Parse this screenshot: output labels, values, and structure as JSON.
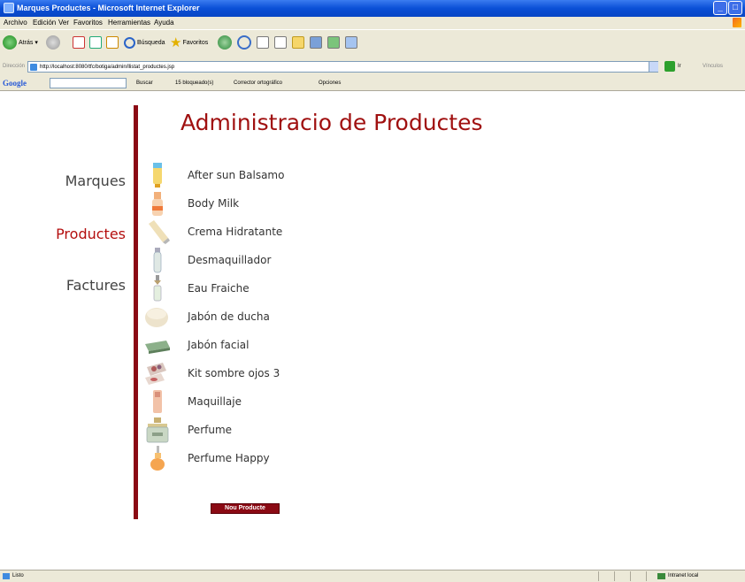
{
  "window": {
    "title": "Marques Productes - Microsoft Internet Explorer"
  },
  "menu": [
    "Archivo",
    "Edición",
    "Ver",
    "Favoritos",
    "Herramientas",
    "Ayuda"
  ],
  "toolbar": {
    "back": "Atrás",
    "search": "Búsqueda",
    "favorites": "Favoritos"
  },
  "address": {
    "label": "Dirección",
    "url": "http://localhost:8080/tfc/botiga/admin/llistat_productes.jsp",
    "go": "Ir",
    "links": "Vínculos"
  },
  "google": {
    "logo": "Google",
    "search": "Buscar",
    "blocked": "15 bloqueado(s)",
    "spell": "Corrector ortográfico",
    "options": "Opciones"
  },
  "page": {
    "heading": "Administracio de Productes",
    "nav": [
      {
        "label": "Marques",
        "active": false
      },
      {
        "label": "Productes",
        "active": true
      },
      {
        "label": "Factures",
        "active": false
      }
    ],
    "products": [
      {
        "name": "After sun Balsamo",
        "icon": "tube-yellow-icon"
      },
      {
        "name": "Body Milk",
        "icon": "bottle-orange-icon"
      },
      {
        "name": "Crema Hidratante",
        "icon": "tube-cream-icon"
      },
      {
        "name": "Desmaquillador",
        "icon": "bottle-clear-icon"
      },
      {
        "name": "Eau Fraiche",
        "icon": "spray-bottle-icon"
      },
      {
        "name": "Jabón de ducha",
        "icon": "jar-icon"
      },
      {
        "name": "Jabón facial",
        "icon": "soap-bar-icon"
      },
      {
        "name": "Kit sombre ojos 3",
        "icon": "eyeshadow-kit-icon"
      },
      {
        "name": "Maquillaje",
        "icon": "makeup-bottle-icon"
      },
      {
        "name": "Perfume",
        "icon": "perfume-bottle-icon"
      },
      {
        "name": "Perfume Happy",
        "icon": "perfume-happy-icon"
      }
    ],
    "new_button": "Nou Producte"
  },
  "status": {
    "left": "Listo",
    "zone": "Intranet local"
  },
  "colors": {
    "accent": "#8b0a14",
    "nav_active": "#b40f0f",
    "heading": "#a01010"
  }
}
